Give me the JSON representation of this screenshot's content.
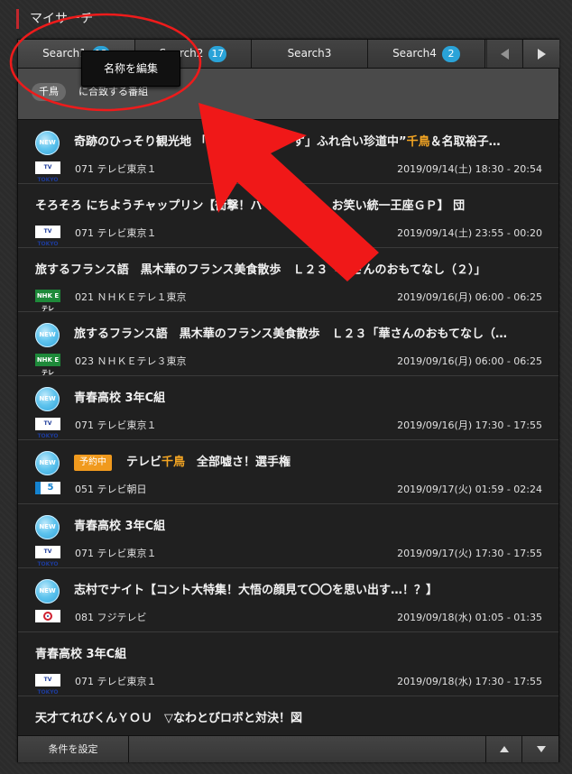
{
  "section_title": "マイサーチ",
  "tabs": [
    {
      "label": "Search1",
      "count": "13"
    },
    {
      "label": "Search2",
      "count": "17"
    },
    {
      "label": "Search3",
      "count": ""
    },
    {
      "label": "Search4",
      "count": "2"
    }
  ],
  "tooltip": "名称を編集",
  "match": {
    "keyword": "千鳥",
    "text": "に合致する番組"
  },
  "rows": [
    {
      "new": true,
      "title_before": "奇跡のひっそり観光地 「中 真朗さまぁ～ず」ふれ合い珍道中”",
      "keyword": "千鳥",
      "title_after": "＆名取裕子…",
      "channel": "071 テレビ東京１",
      "logo": "tvtokyo",
      "datetime": "2019/09/14(土) 18:30 - 20:54"
    },
    {
      "new": false,
      "title_before": "そろそろ にちようチャップリン【衝撃！ハープコント　お笑い統一王座ＧＰ】 団",
      "keyword": "",
      "title_after": "",
      "channel": "071 テレビ東京１",
      "logo": "tvtokyo",
      "datetime": "2019/09/14(土) 23:55 - 00:20"
    },
    {
      "new": false,
      "title_before": "旅するフランス語　黒木華のフランス美食散歩　Ｌ２３「華さんのおもてなし（２）」",
      "keyword": "",
      "title_after": "",
      "channel": "021 ＮＨＫＥテレ１東京",
      "logo": "nhketele",
      "datetime": "2019/09/16(月) 06:00 - 06:25"
    },
    {
      "new": true,
      "title_before": "旅するフランス語　黒木華のフランス美食散歩　Ｌ２３「華さんのおもてなし（…",
      "keyword": "",
      "title_after": "",
      "channel": "023 ＮＨＫＥテレ３東京",
      "logo": "nhketele",
      "datetime": "2019/09/16(月) 06:00 - 06:25"
    },
    {
      "new": true,
      "title_before": "青春高校 3年C組",
      "keyword": "",
      "title_after": "",
      "channel": "071 テレビ東京１",
      "logo": "tvtokyo",
      "datetime": "2019/09/16(月) 17:30 - 17:55"
    },
    {
      "new": true,
      "reserved": "予約中",
      "title_before": "テレビ",
      "keyword": "千鳥",
      "title_after": "　全部嘘さ！選手権",
      "channel": "051 テレビ朝日",
      "logo": "asahi",
      "datetime": "2019/09/17(火) 01:59 - 02:24"
    },
    {
      "new": true,
      "title_before": "青春高校 3年C組",
      "keyword": "",
      "title_after": "",
      "channel": "071 テレビ東京１",
      "logo": "tvtokyo",
      "datetime": "2019/09/17(火) 17:30 - 17:55"
    },
    {
      "new": true,
      "title_before": "志村でナイト【コント大特集！大悟の顔見て〇〇を思い出す…！？】",
      "keyword": "",
      "title_after": "",
      "channel": "081 フジテレビ",
      "logo": "fuji",
      "datetime": "2019/09/18(水) 01:05 - 01:35"
    },
    {
      "new": false,
      "title_before": "青春高校 3年C組",
      "keyword": "",
      "title_after": "",
      "channel": "071 テレビ東京１",
      "logo": "tvtokyo",
      "datetime": "2019/09/18(水) 17:30 - 17:55"
    },
    {
      "new": false,
      "title_before": "天才てれびくんＹＯＵ　▽なわとびロボと対決！図",
      "keyword": "",
      "title_after": "",
      "channel": "",
      "logo": "",
      "datetime": ""
    }
  ],
  "new_label": "NEW",
  "logo_text": {
    "tvtokyo": "TV TOKYO",
    "nhketele": "NHK Eテレ",
    "asahi": "5"
  },
  "bottom": {
    "condition_button": "条件を設定"
  },
  "colors": {
    "accent_red": "#c1272d",
    "badge_blue": "#2aa3d8",
    "keyword_orange": "#f5a623",
    "reserve_orange": "#f09a1e",
    "annotation_red": "#ff0000"
  }
}
